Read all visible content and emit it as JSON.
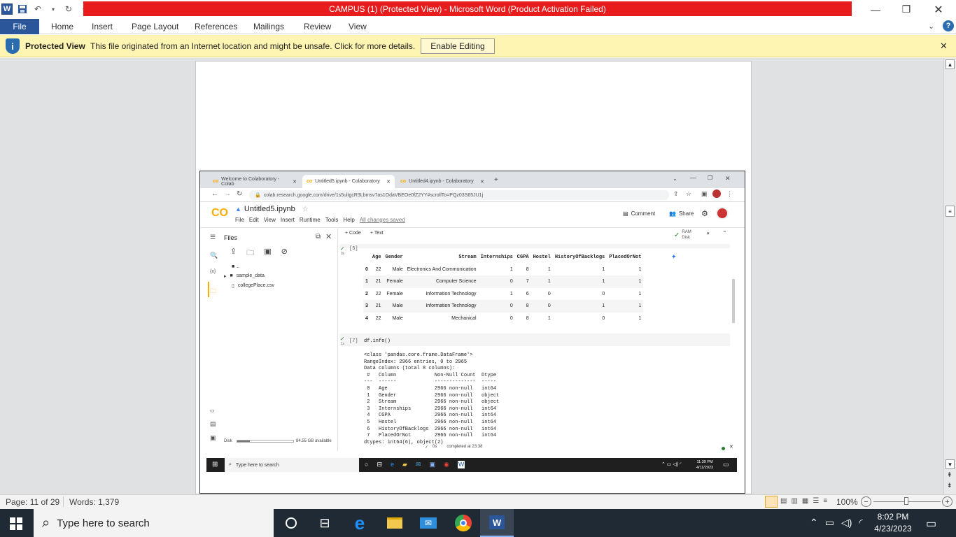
{
  "window": {
    "title": "CAMPUS (1) (Protected View)  -  Microsoft Word (Product Activation Failed)",
    "min_label": "—",
    "max_label": "❐",
    "close_label": "✕"
  },
  "ribbon": {
    "file": "File",
    "tabs": [
      "Home",
      "Insert",
      "Page Layout",
      "References",
      "Mailings",
      "Review",
      "View"
    ]
  },
  "protected": {
    "title": "Protected View",
    "message": "This file originated from an Internet location and might be unsafe. Click for more details.",
    "button": "Enable Editing"
  },
  "browser": {
    "tabs": [
      "Welcome to Colaboratory - Colab",
      "Untitled5.ipynb - Colaboratory",
      "Untitled4.ipynb - Colaboratory"
    ],
    "url": "colab.research.google.com/drive/1s5ultgcR3Lbmsv7as1OdaVBEOe0fZ2YY#scrollTo=PQz03S65JU1j"
  },
  "colab": {
    "logo": "CO",
    "notebook": "Untitled5.ipynb",
    "menu": [
      "File",
      "Edit",
      "View",
      "Insert",
      "Runtime",
      "Tools",
      "Help"
    ],
    "saved": "All changes saved",
    "comment": "Comment",
    "share": "Share",
    "add_code": "+ Code",
    "add_text": "+ Text",
    "ram": "RAM",
    "disk": "Disk",
    "files_title": "Files",
    "tree": [
      "..",
      "sample_data",
      "collegePlace.csv"
    ],
    "disk_label": "Disk",
    "disk_available": "84.55 GB available",
    "cell5_prompt": "[5]",
    "cell7_prompt": "[7]",
    "cell7_code": "df.info()",
    "status_time": "0s",
    "status_text": "completed at 23:38",
    "exec_time": "0s",
    "exec_time2": "1s"
  },
  "df_table": {
    "columns": [
      "",
      "Age",
      "Gender",
      "Stream",
      "Internships",
      "CGPA",
      "Hostel",
      "HistoryOfBacklogs",
      "PlacedOrNot"
    ],
    "rows": [
      [
        "0",
        "22",
        "Male",
        "Electronics And Communication",
        "1",
        "8",
        "1",
        "1",
        "1"
      ],
      [
        "1",
        "21",
        "Female",
        "Computer Science",
        "0",
        "7",
        "1",
        "1",
        "1"
      ],
      [
        "2",
        "22",
        "Female",
        "Information Technology",
        "1",
        "6",
        "0",
        "0",
        "1"
      ],
      [
        "3",
        "21",
        "Male",
        "Information Technology",
        "0",
        "8",
        "0",
        "1",
        "1"
      ],
      [
        "4",
        "22",
        "Male",
        "Mechanical",
        "0",
        "8",
        "1",
        "0",
        "1"
      ]
    ]
  },
  "info_output": "<class 'pandas.core.frame.DataFrame'>\nRangeIndex: 2966 entries, 0 to 2965\nData columns (total 8 columns):\n #   Column             Non-Null Count  Dtype \n---  ------             --------------  ----- \n 0   Age                2966 non-null   int64 \n 1   Gender             2966 non-null   object\n 2   Stream             2966 non-null   object\n 3   Internships        2966 non-null   int64 \n 4   CGPA               2966 non-null   int64 \n 5   Hostel             2966 non-null   int64 \n 6   HistoryOfBacklogs  2966 non-null   int64 \n 7   PlacedOrNot        2966 non-null   int64 \ndtypes: int64(6), object(2)",
  "inner_taskbar": {
    "search": "Type here to search",
    "time": "11:39 PM",
    "date": "4/11/2023"
  },
  "statusbar": {
    "page": "Page: 11 of 29",
    "words": "Words: 1,379",
    "zoom": "100%"
  },
  "taskbar": {
    "search": "Type here to search",
    "time": "8:02 PM",
    "date": "4/23/2023"
  }
}
